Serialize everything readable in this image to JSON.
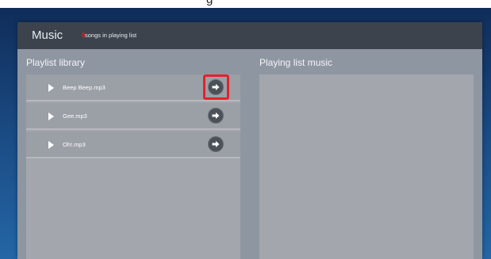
{
  "top_caption": "g",
  "header": {
    "title": "Music",
    "count": "0",
    "count_suffix": "songs in playing list"
  },
  "library": {
    "title": "Playlist library",
    "songs": [
      {
        "name": "Beep Beep.mp3"
      },
      {
        "name": "Gee.mp3"
      },
      {
        "name": "Oh!.mp3"
      }
    ]
  },
  "playing": {
    "title": "Playing list music"
  },
  "colors": {
    "header_bg": "#3c434c",
    "panel_bg": "#8e96a1",
    "highlight": "#e8202a",
    "count_color": "#d22828"
  },
  "icons": {
    "play": "play-icon",
    "add": "arrow-right-icon"
  }
}
